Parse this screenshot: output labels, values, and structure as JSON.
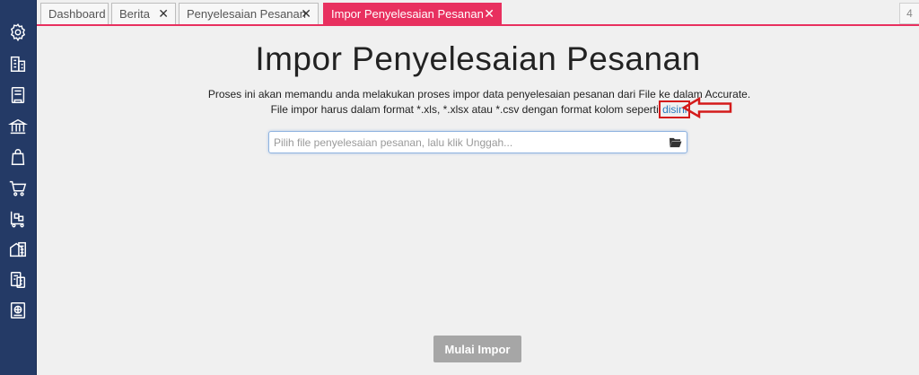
{
  "tabs": [
    {
      "label": "Dashboard",
      "closable": false,
      "active": false
    },
    {
      "label": "Berita",
      "closable": true,
      "active": false
    },
    {
      "label": "Penyelesaian Pesanan",
      "closable": true,
      "active": false
    },
    {
      "label": "Impor Penyelesaian Pesanan",
      "closable": true,
      "active": true
    }
  ],
  "tab_close_glyph": "✕",
  "tab_count": "4",
  "sidebar": {
    "icons": [
      "settings-icon",
      "building-icon",
      "ledger-icon",
      "bank-icon",
      "shopping-bag-icon",
      "cart-icon",
      "delivery-cart-icon",
      "warehouse-report-icon",
      "tax-report-icon",
      "globe-report-icon"
    ]
  },
  "main": {
    "title": "Impor Penyelesaian Pesanan",
    "description_text": "Proses ini akan memandu anda melakukan proses impor data penyelesaian pesanan dari File ke dalam Accurate. File impor harus dalam format *.xls, *.xlsx atau *.csv dengan format kolom seperti ",
    "link_text": "disini",
    "file_input": {
      "value": "",
      "placeholder": "Pilih file penyelesaian pesanan, lalu klik Unggah..."
    },
    "submit_label": "Mulai Impor"
  },
  "colors": {
    "sidebar": "#243a66",
    "active_tab": "#e8305f",
    "link": "#2a7bbf",
    "annotation": "#d41b1b",
    "button_disabled": "#a6a6a6"
  }
}
